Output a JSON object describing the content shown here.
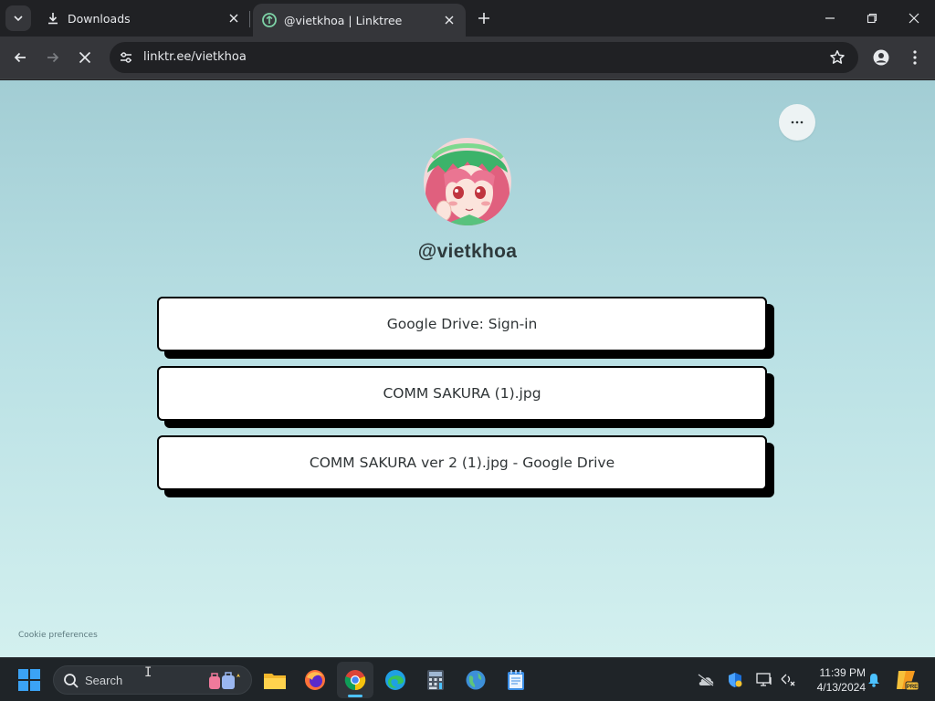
{
  "browser": {
    "tabs": [
      {
        "title": "Downloads",
        "icon": "download-icon",
        "active": false
      },
      {
        "title": "@vietkhoa | Linktree",
        "icon": "linktree-icon",
        "active": true
      }
    ],
    "address": "linktr.ee/vietkhoa"
  },
  "profile": {
    "username": "@vietkhoa",
    "avatar": "anime-girl-pink-hair-avatar"
  },
  "links": [
    {
      "label": "Google Drive: Sign-in"
    },
    {
      "label": "COMM SAKURA (1).jpg"
    },
    {
      "label": "COMM SAKURA ver 2 (1).jpg - Google Drive"
    }
  ],
  "footer": {
    "cookie_label": "Cookie preferences"
  },
  "taskbar": {
    "search_label": "Search",
    "apps": [
      "file-explorer-icon",
      "firefox-icon",
      "chrome-icon",
      "edge-icon",
      "calculator-icon",
      "maps-icon",
      "notepad-icon"
    ],
    "time": "11:39 PM",
    "date": "4/13/2024"
  },
  "colors": {
    "page_top": "#a2cdd4",
    "page_bottom": "#d3f0ef",
    "button_bg": "#ffffff",
    "button_border": "#000000",
    "accent": "#4cc2ff"
  }
}
